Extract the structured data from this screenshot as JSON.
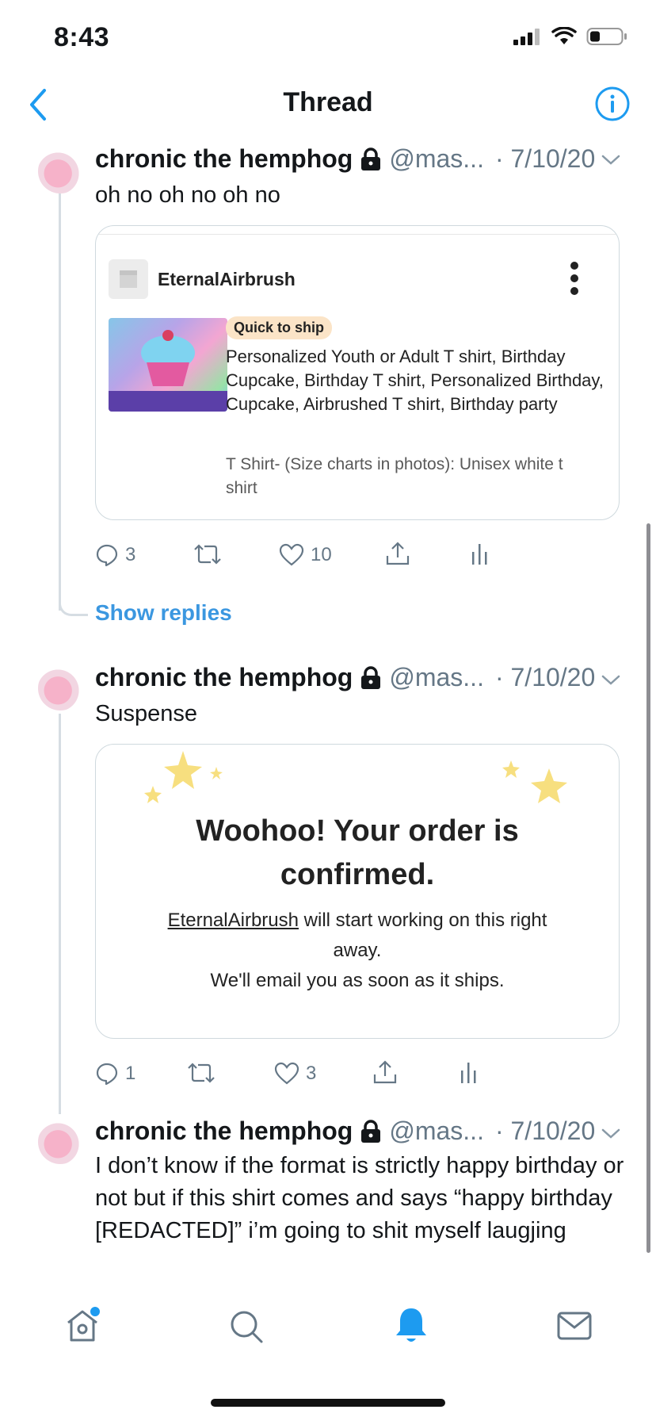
{
  "status": {
    "time": "8:43"
  },
  "nav": {
    "title": "Thread"
  },
  "tweets": [
    {
      "name": "chronic the hemphog",
      "handle": "@mas...",
      "date": "· 7/10/20",
      "text": "oh no oh no oh no",
      "replies": "3",
      "likes": "10"
    },
    {
      "name": "chronic the hemphog",
      "handle": "@mas...",
      "date": "· 7/10/20",
      "text": "Suspense",
      "replies": "1",
      "likes": "3"
    },
    {
      "name": "chronic the hemphog",
      "handle": "@mas...",
      "date": "· 7/10/20",
      "text": "I don’t know if the format is strictly happy birthday or not but if this shirt comes and says “happy birthday [REDACTED]” i’m going to shit myself laugjing"
    }
  ],
  "etsy_card": {
    "store": "EternalAirbrush",
    "badge": "Quick to ship",
    "title": "Personalized Youth or Adult T shirt, Birthday Cupcake, Birthday T shirt, Personalized Birthday, Cupcake, Airbrushed T shirt, Birthday party",
    "desc": "T Shirt- (Size charts in photos): Unisex white t shirt"
  },
  "show_replies": "Show replies",
  "order_card": {
    "title": "Woohoo! Your order is confirmed.",
    "store_link": "EternalAirbrush",
    "line1_rest": " will start working on this right away.",
    "line2": "We'll email you as soon as it ships."
  },
  "colors": {
    "accent": "#1d9bf0",
    "link": "#3b97e0",
    "muted": "#657786"
  },
  "icons": [
    "back-chevron-icon",
    "info-icon",
    "lock-icon",
    "chevron-down-icon",
    "reply-icon",
    "retweet-icon",
    "like-icon",
    "share-icon",
    "analytics-icon",
    "home-icon",
    "search-icon",
    "notifications-icon",
    "messages-icon"
  ]
}
